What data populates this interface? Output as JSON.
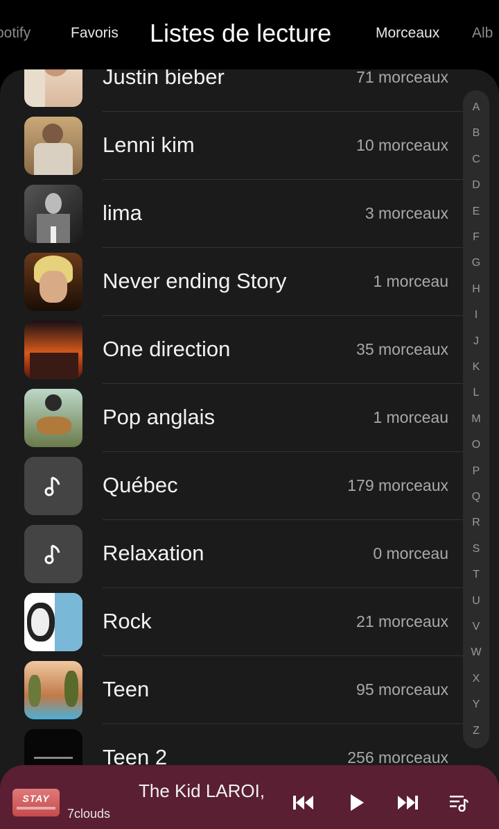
{
  "tabs": [
    {
      "label": "potify"
    },
    {
      "label": "Favoris"
    },
    {
      "label": "Listes de lecture"
    },
    {
      "label": "Morceaux"
    },
    {
      "label": "Alb"
    }
  ],
  "playlists": [
    {
      "title": "Justin bieber",
      "count": "71 morceaux",
      "thumb": "portrait"
    },
    {
      "title": "Lenni kim",
      "count": "10 morceaux",
      "thumb": "street"
    },
    {
      "title": "lima",
      "count": "3 morceaux",
      "thumb": "bw"
    },
    {
      "title": "Never ending Story",
      "count": "1 morceau",
      "thumb": "blond"
    },
    {
      "title": "One direction",
      "count": "35 morceaux",
      "thumb": "concert"
    },
    {
      "title": "Pop anglais",
      "count": "1 morceau",
      "thumb": "guitar"
    },
    {
      "title": "Québec",
      "count": "179 morceaux",
      "thumb": "music-note-icon"
    },
    {
      "title": "Relaxation",
      "count": "0 morceau",
      "thumb": "music-note-icon"
    },
    {
      "title": "Rock",
      "count": "21 morceaux",
      "thumb": "poster"
    },
    {
      "title": "Teen",
      "count": "95 morceaux",
      "thumb": "forest"
    },
    {
      "title": "Teen 2",
      "count": "256 morceaux",
      "thumb": "dark"
    }
  ],
  "alphabet": [
    "A",
    "B",
    "C",
    "D",
    "E",
    "F",
    "G",
    "H",
    "I",
    "J",
    "K",
    "L",
    "M",
    "O",
    "P",
    "Q",
    "R",
    "S",
    "T",
    "U",
    "V",
    "W",
    "X",
    "Y",
    "Z"
  ],
  "player": {
    "cover_text": "STAY",
    "title": "The Kid LAROI,",
    "artist": "7clouds"
  },
  "colors": {
    "background": "#1b1b1b",
    "player": "#5a1f33",
    "secondary_text": "#a9a9a9"
  }
}
